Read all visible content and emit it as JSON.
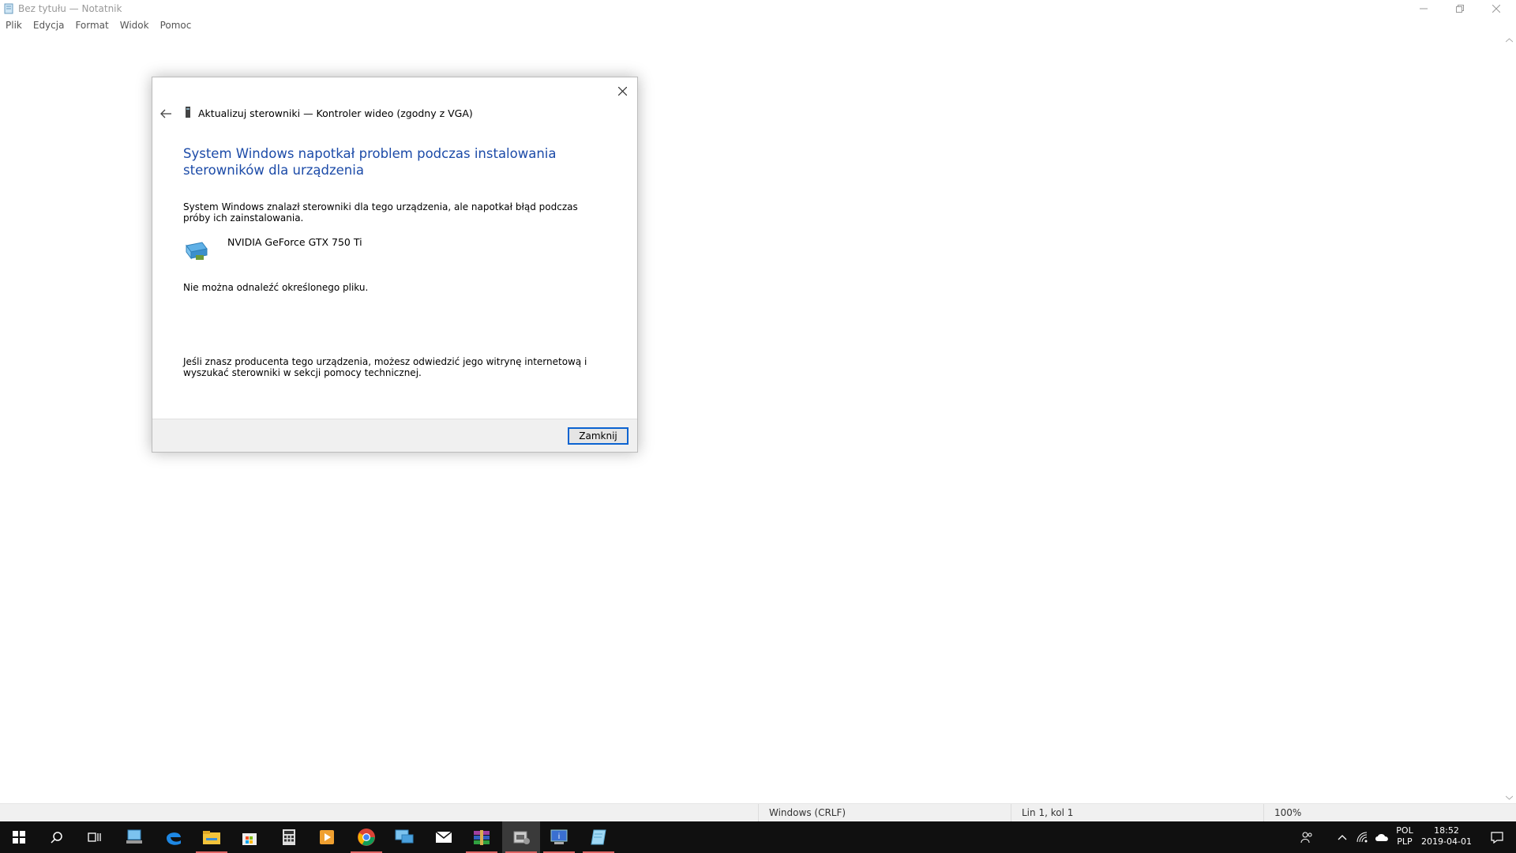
{
  "window": {
    "title": "Bez tytułu — Notatnik",
    "menu": [
      "Plik",
      "Edycja",
      "Format",
      "Widok",
      "Pomoc"
    ]
  },
  "statusbar": {
    "encoding": "Windows (CRLF)",
    "position": "Lin 1, kol 1",
    "zoom": "100%"
  },
  "dialog": {
    "header": "Aktualizuj sterowniki — Kontroler wideo (zgodny z VGA)",
    "heading": "System Windows napotkał problem podczas instalowania sterowników dla urządzenia",
    "description": "System Windows znalazł sterowniki dla tego urządzenia, ale napotkał błąd podczas próby ich zainstalowania.",
    "device_name": "NVIDIA GeForce GTX 750 Ti",
    "error": "Nie można odnaleźć określonego pliku.",
    "hint": "Jeśli znasz producenta tego urządzenia, możesz odwiedzić jego witrynę internetową i wyszukać sterowniki w sekcji pomocy technicznej.",
    "close_button": "Zamknij"
  },
  "taskbar": {
    "apps": [
      "start-icon",
      "search-icon",
      "task-view-icon",
      "device-manager-icon",
      "edge-icon",
      "file-explorer-icon",
      "store-icon",
      "calculator-icon",
      "media-player-icon",
      "chrome-icon",
      "network-icon",
      "mail-icon",
      "winrar-icon",
      "driver-install-icon",
      "system-info-icon",
      "notepad-icon"
    ],
    "lang_top": "POL",
    "lang_bottom": "PLP",
    "time": "18:52",
    "date": "2019-04-01"
  },
  "colors": {
    "heading_blue": "#1c4ba8",
    "taskbar": "#101010",
    "accent": "#0b63d1"
  }
}
